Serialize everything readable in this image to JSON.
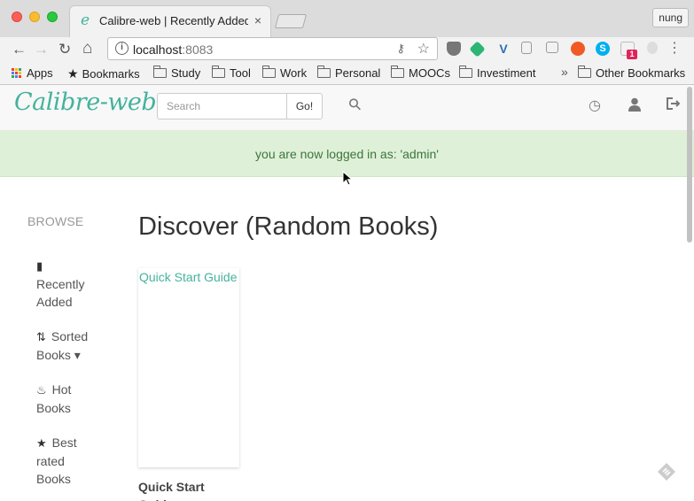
{
  "browser": {
    "tab_title": "Calibre-web | Recently Added",
    "tab_favicon": "e",
    "tab_close": "×",
    "profile": "nung",
    "url_host": "localhost",
    "url_port": ":8083",
    "back_icon": "←",
    "forward_icon": "→",
    "reload_icon": "↻",
    "home_icon": "⌂",
    "info_icon": "i",
    "key_icon": "⚷",
    "star_icon": "☆",
    "menu_icon": "⋮",
    "extension_badge": "1"
  },
  "bookmarks": {
    "apps": "Apps",
    "bookmarks": "Bookmarks",
    "study": "Study",
    "tool": "Tool",
    "work": "Work",
    "personal": "Personal",
    "moocs": "MOOCs",
    "investiment": "Investiment",
    "overflow": "»",
    "other": "Other Bookmarks"
  },
  "navbar": {
    "brand": "Calibre-web",
    "search_placeholder": "Search",
    "go_label": "Go!",
    "search_icon": "⚲",
    "tasks_icon": "◷",
    "user_icon": "●",
    "logout_icon": "⇥"
  },
  "alert": {
    "text": "you are now logged in as: 'admin'"
  },
  "sidebar": {
    "title": "BROWSE",
    "items": [
      {
        "icon": "▮",
        "line1": "",
        "line2": "Recently",
        "line3": "Added"
      },
      {
        "icon": "⇅",
        "line1": "Sorted",
        "line2": "Books ▾",
        "line3": ""
      },
      {
        "icon": "♨",
        "line1": "Hot",
        "line2": "Books",
        "line3": ""
      },
      {
        "icon": "★",
        "line1": "Best",
        "line2": "rated",
        "line3": "Books"
      }
    ]
  },
  "main": {
    "title": "Discover (Random Books)",
    "books": [
      {
        "cover_text": "Quick Start Guide",
        "title": "Quick Start Guide"
      }
    ]
  }
}
